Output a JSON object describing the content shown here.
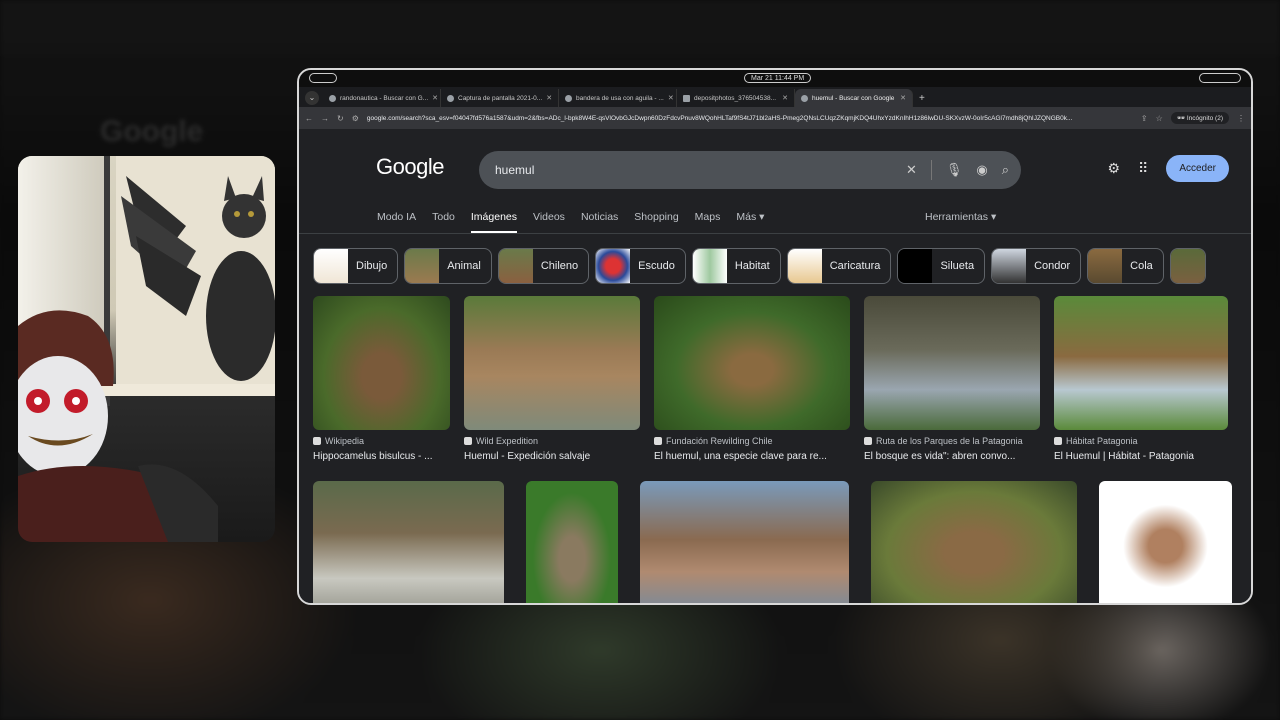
{
  "system": {
    "clock": "Mar 21  11:44 PM"
  },
  "browser": {
    "tabs": [
      {
        "title": "randonautica - Buscar con G..."
      },
      {
        "title": "Captura de pantalla 2021-0..."
      },
      {
        "title": "bandera de usa con aguila - ..."
      },
      {
        "title": "depositphotos_376504538..."
      },
      {
        "title": "huemul - Buscar con Google",
        "active": true
      }
    ],
    "url": "google.com/search?sca_esv=f04047fd576a1587&udm=2&fbs=ADc_l-bpk8W4E-qsVlOvbGJcDwpn60DzFdcvPnuv8WQohHLTaf9fS4tJ71bl2aHS-Pmeg2QNsLCUqzZKqmjKDQ4UhxYzdKnIhH1z86lwDU-SKXvzW-0oIr5cAGl7mdh8jQhIJZQNGB0k...",
    "incognito_label": "Incógnito (2)"
  },
  "google": {
    "logo": "Google",
    "query": "huemul",
    "signin": "Acceder",
    "nav": [
      "Modo IA",
      "Todo",
      "Imágenes",
      "Videos",
      "Noticias",
      "Shopping",
      "Maps",
      "Más ▾"
    ],
    "tools": "Herramientas ▾",
    "chips": [
      "Dibujo",
      "Animal",
      "Chileno",
      "Escudo",
      "Habitat",
      "Caricatura",
      "Silueta",
      "Condor",
      "Cola"
    ],
    "row1": [
      {
        "source": "Wikipedia",
        "title": "Hippocamelus bisulcus - ..."
      },
      {
        "source": "Wild Expedition",
        "title": "Huemul - Expedición salvaje"
      },
      {
        "source": "Fundación Rewilding Chile",
        "title": "El huemul, una especie clave para re..."
      },
      {
        "source": "Ruta de los Parques de la Patagonia",
        "title": "El bosque es vida\": abren convo..."
      },
      {
        "source": "Hábitat Patagonia",
        "title": "El Huemul | Hábitat - Patagonia"
      }
    ]
  },
  "colors": {
    "accent": "#8ab4f8",
    "page_bg": "#202124"
  }
}
